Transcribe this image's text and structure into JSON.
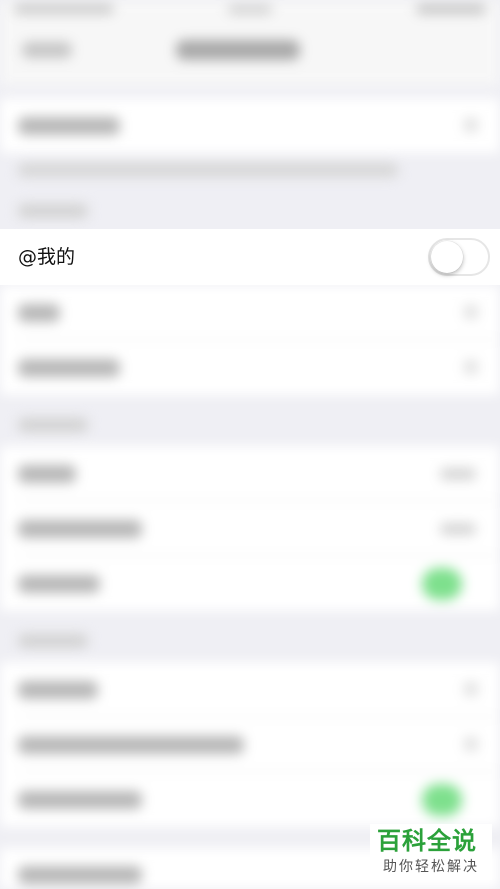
{
  "settings": {
    "mention_row": {
      "label": "@我的",
      "toggle_state": "off"
    }
  },
  "watermark": {
    "title": "百科全说",
    "subtitle": "助你轻松解决",
    "color": "#2ba13a"
  },
  "colors": {
    "background": "#efeff4",
    "toggle_on": "#4cd964"
  }
}
